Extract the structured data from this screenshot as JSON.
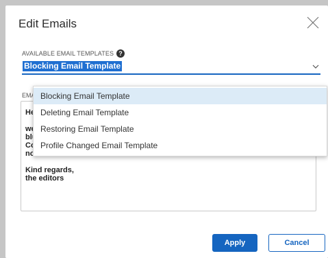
{
  "dialog": {
    "title": "Edit Emails",
    "template_label": "AVAILABLE EMAIL TEMPLATES",
    "selected_template": "Blocking Email Template",
    "email_label": "EMA",
    "email_body": "He\n\nwe\nblu\nCo\nno\n\nKind regards,\nthe editors",
    "options": [
      "Blocking Email Template",
      "Deleting Email Template",
      "Restoring Email Template",
      "Profile Changed Email Template"
    ],
    "apply_label": "Apply",
    "cancel_label": "Cancel"
  },
  "colors": {
    "accent": "#1565c0",
    "selected_option_bg": "#dcebf7"
  },
  "icons": {
    "close": "close-icon",
    "help": "help-icon",
    "dropdown": "chevron-down-icon"
  }
}
